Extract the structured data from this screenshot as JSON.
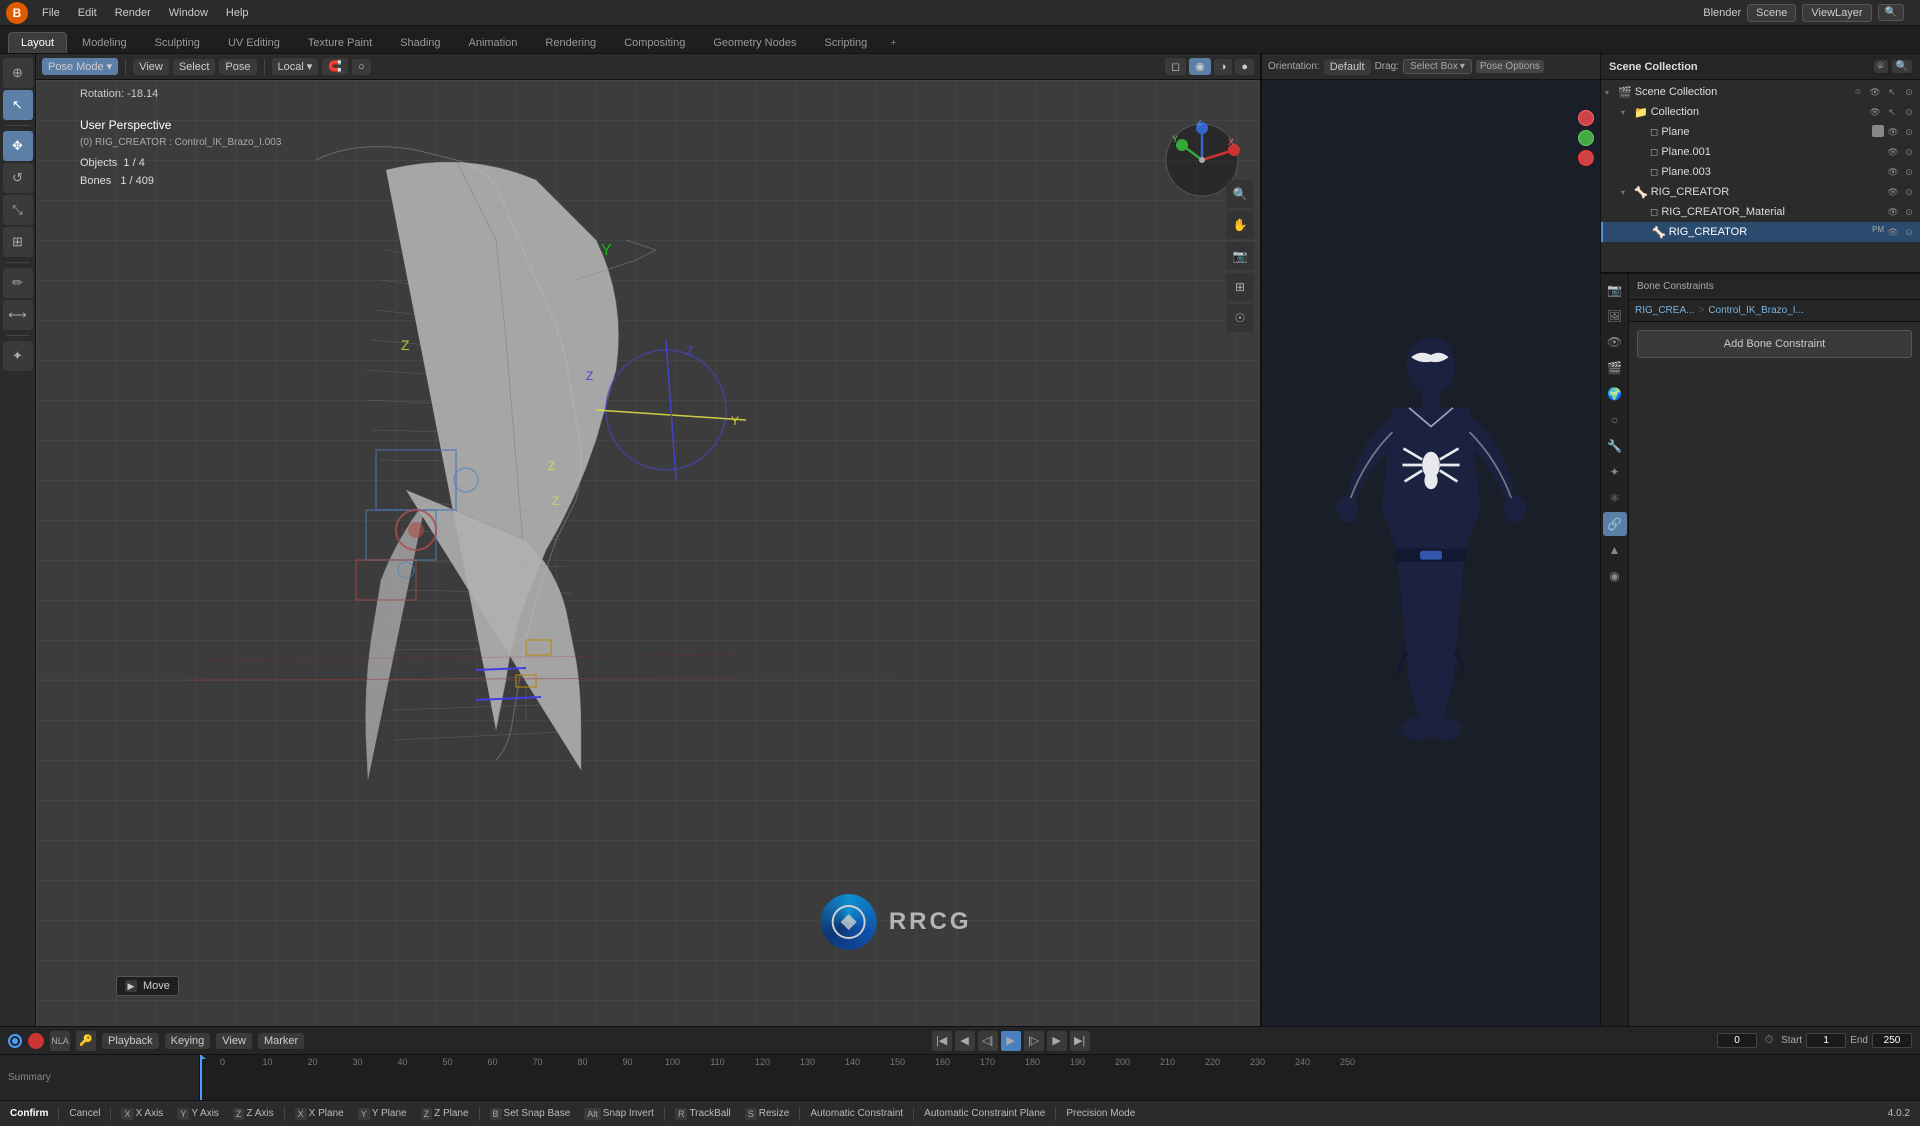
{
  "app": {
    "title": "Blender",
    "logo": "B"
  },
  "top_menu": {
    "items": [
      "Blender",
      "File",
      "Edit",
      "Render",
      "Window",
      "Help"
    ]
  },
  "workspace_tabs": {
    "tabs": [
      "Layout",
      "Modeling",
      "Sculpting",
      "UV Editing",
      "Texture Paint",
      "Shading",
      "Animation",
      "Rendering",
      "Compositing",
      "Geometry Nodes",
      "Scripting"
    ],
    "active": "Layout",
    "add_label": "+"
  },
  "viewport": {
    "mode": "Pose Mode",
    "view_label": "View",
    "select_label": "Select",
    "pose_label": "Pose",
    "orientation": "Local",
    "rotation_info": "Rotation: -18.14",
    "perspective": "User Perspective",
    "object_info": "(0) RIG_CREATOR : Control_IK_Brazo_I.003",
    "objects_label": "Objects",
    "objects_count": "1 / 4",
    "bones_label": "Bones",
    "bones_count": "1 / 409"
  },
  "secondary_viewport": {
    "orientation": "Default",
    "drag": "Drag:",
    "select_box": "Select Box",
    "pose_options": "Pose Options"
  },
  "outliner": {
    "title": "Scene Collection",
    "items": [
      {
        "label": "Scene Collection",
        "level": 0,
        "icon": "🎬",
        "expanded": true
      },
      {
        "label": "Collection",
        "level": 1,
        "icon": "📁",
        "expanded": true
      },
      {
        "label": "Plane",
        "level": 2,
        "icon": "◻"
      },
      {
        "label": "Plane.001",
        "level": 2,
        "icon": "◻"
      },
      {
        "label": "Plane.003",
        "level": 2,
        "icon": "◻"
      },
      {
        "label": "RIG_CREATOR",
        "level": 1,
        "icon": "🦴",
        "expanded": true
      },
      {
        "label": "RIG_CREATOR_Material",
        "level": 2,
        "icon": "◻"
      },
      {
        "label": "RIG_CREATOR",
        "level": 2,
        "icon": "🦴",
        "active": true
      }
    ]
  },
  "properties": {
    "breadcrumb": [
      "RIG_CREA...",
      ">",
      "Control_IK_Brazo_I..."
    ],
    "add_constraint": "Add Bone Constraint"
  },
  "timeline": {
    "playback": "Playback",
    "keying": "Keying",
    "view": "View",
    "marker": "Marker",
    "start": "Start",
    "start_val": "1",
    "end": "End",
    "end_val": "250",
    "current_frame": "0",
    "frame_numbers": [
      "0",
      "10",
      "20",
      "30",
      "40",
      "50",
      "60",
      "70",
      "80",
      "90",
      "100",
      "110",
      "120",
      "130",
      "140",
      "150",
      "160",
      "170",
      "180",
      "190",
      "200",
      "210",
      "220",
      "230",
      "240",
      "250"
    ]
  },
  "bottom_bar": {
    "confirm": "Confirm",
    "cancel": "Cancel",
    "x_axis": "X Axis",
    "y_axis": "Y Axis",
    "z_axis": "Z Axis",
    "x_plane": "X Plane",
    "y_plane": "Y Plane",
    "z_plane": "Z Plane",
    "set_snap_base": "Set Snap Base",
    "snap_invert": "Snap Invert",
    "trackball": "TrackBall",
    "resize": "Resize",
    "auto_constraint": "Automatic Constraint",
    "auto_constraint_plane": "Automatic Constraint Plane",
    "precision_mode": "Precision Mode",
    "version": "4.0.2"
  },
  "move_tooltip": {
    "icon": "▶",
    "label": "Move"
  },
  "icons": {
    "arrow_right": "▶",
    "arrow_left": "◀",
    "cursor": "⊕",
    "select": "↖",
    "move": "✥",
    "rotate": "↺",
    "scale": "⤡",
    "transform": "⊞",
    "annotate": "✏",
    "measure": "📏",
    "eye": "👁",
    "camera": "📷",
    "render": "🎥",
    "grid": "⊞",
    "bone": "🦴",
    "mesh": "◻",
    "collection": "📁",
    "scene": "🎬",
    "object": "○",
    "constraint": "🔗",
    "particles": "✦",
    "physics": "⚛"
  }
}
